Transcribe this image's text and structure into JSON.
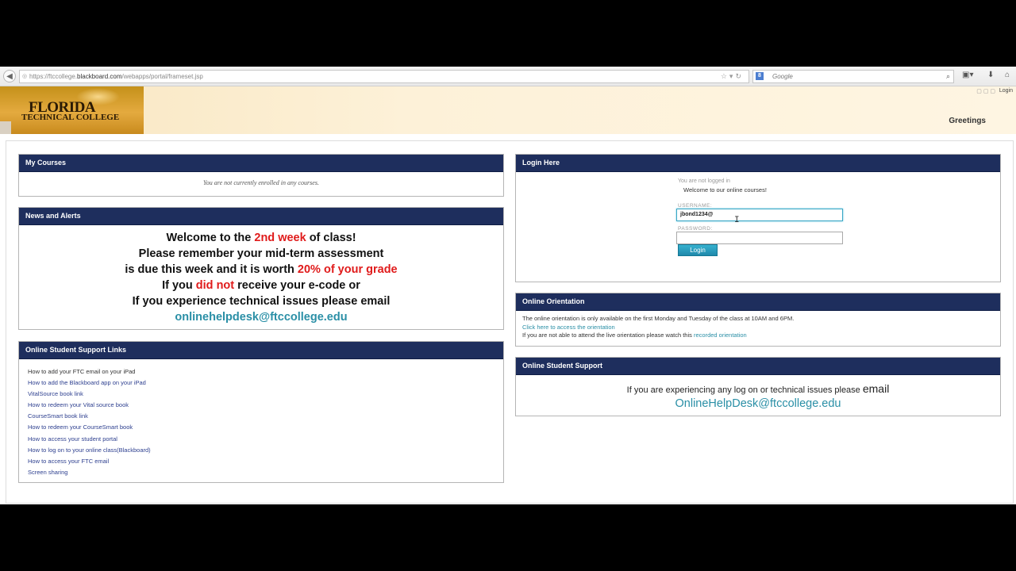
{
  "browser": {
    "url_prefix": "https://ftccollege.",
    "url_host": "blackboard.com",
    "url_path": "/webapps/portal/frameset.jsp",
    "search_placeholder": "Google",
    "search_engine_letter": "8"
  },
  "header": {
    "logo_line1": "FLORIDA",
    "logo_line2": "TECHNICAL COLLEGE",
    "login_link": "Login",
    "greetings": "Greetings"
  },
  "my_courses": {
    "title": "My Courses",
    "note": "You are not currently enrolled in any courses."
  },
  "news": {
    "title": "News and Alerts",
    "line1_a": "Welcome to the ",
    "line1_b": "2nd week",
    "line1_c": " of class!",
    "line2": "Please remember your mid-term assessment",
    "line3_a": "is due this week and it is worth ",
    "line3_b": "20% of your grade",
    "line4_a": "If you ",
    "line4_b": "did not",
    "line4_c": " receive your e-code or",
    "line5": "If you experience technical issues please email",
    "line6": "onlinehelpdesk@ftccollege.edu"
  },
  "support_links": {
    "title": "Online Student Support Links",
    "items": [
      "How to add your FTC email on your iPad",
      "How to add the Blackboard app on your iPad",
      "VitalSource book link",
      "How to redeem your Vital source book",
      "CourseSmart book link",
      "How to redeem your CourseSmart book",
      "How to access your student portal",
      "How to log on to your online class(Blackboard)",
      "How to access your FTC email",
      "Screen sharing"
    ]
  },
  "login": {
    "title": "Login Here",
    "status": "You are not logged in",
    "welcome": "Welcome to our online courses!",
    "username_label": "USERNAME:",
    "username_value": "jbond1234@",
    "password_label": "PASSWORD:",
    "button": "Login"
  },
  "orientation": {
    "title": "Online Orientation",
    "line1": "The online orientation is only available on the first Monday and Tuesday of the class at 10AM and 6PM.",
    "link1": "Click here to access the orientation",
    "line3_a": "If you are not able to attend the live orientation please watch this ",
    "line3_link": "recorded orientation"
  },
  "support": {
    "title": "Online Student Support",
    "line1_a": "If you are experiencing any log on or technical issues please ",
    "line1_b": "email",
    "email": "OnlineHelpDesk@ftccollege.edu"
  }
}
